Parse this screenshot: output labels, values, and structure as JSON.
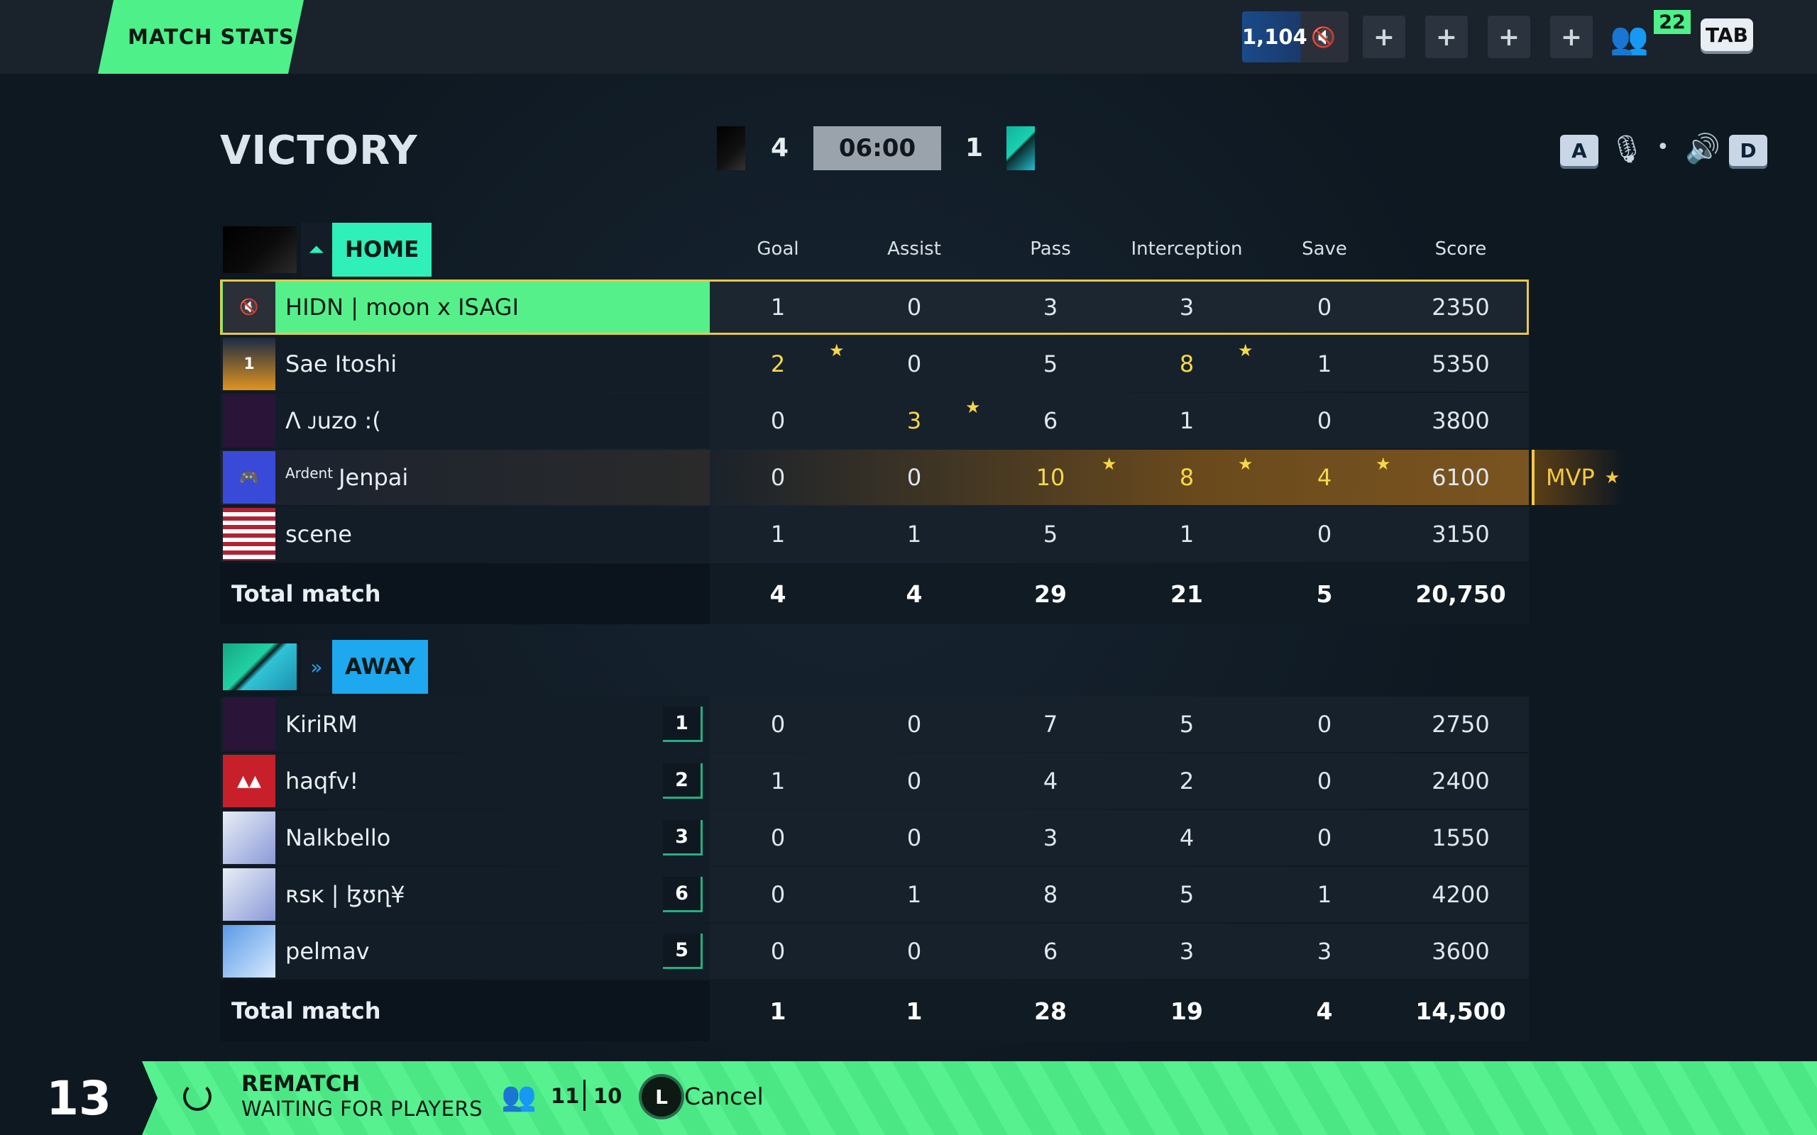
{
  "topbar": {
    "tab_label": "MATCH STATS",
    "elo": "1,104",
    "plus": "+",
    "party_count": "22",
    "tab_key": "TAB"
  },
  "header": {
    "result": "VICTORY",
    "home_score": "4",
    "timer": "06:00",
    "away_score": "1",
    "key_left": "A",
    "key_right": "D"
  },
  "columns": [
    "Goal",
    "Assist",
    "Pass",
    "Interception",
    "Save",
    "Score"
  ],
  "home": {
    "team_name": "HOME",
    "players": [
      {
        "name": "HIDN | moon x ISAGI",
        "prefix": "",
        "stats": [
          "1",
          "0",
          "3",
          "3",
          "0",
          "2350"
        ],
        "gold": [
          false,
          false,
          false,
          false,
          false,
          false
        ],
        "stars": [
          false,
          false,
          false,
          false,
          false,
          false
        ]
      },
      {
        "name": "Sae Itoshi",
        "prefix": "",
        "stats": [
          "2",
          "0",
          "5",
          "8",
          "1",
          "5350"
        ],
        "gold": [
          true,
          false,
          false,
          true,
          false,
          false
        ],
        "stars": [
          true,
          false,
          false,
          true,
          false,
          false
        ]
      },
      {
        "name": "Λ ᴊuzo :(",
        "prefix": "",
        "stats": [
          "0",
          "3",
          "6",
          "1",
          "0",
          "3800"
        ],
        "gold": [
          false,
          true,
          false,
          false,
          false,
          false
        ],
        "stars": [
          false,
          true,
          false,
          false,
          false,
          false
        ]
      },
      {
        "name": "Jenpai",
        "prefix": "Ardent",
        "stats": [
          "0",
          "0",
          "10",
          "8",
          "4",
          "6100"
        ],
        "gold": [
          false,
          false,
          true,
          true,
          true,
          false
        ],
        "stars": [
          false,
          false,
          true,
          true,
          true,
          false
        ]
      },
      {
        "name": "scene",
        "prefix": "",
        "stats": [
          "1",
          "1",
          "5",
          "1",
          "0",
          "3150"
        ],
        "gold": [
          false,
          false,
          false,
          false,
          false,
          false
        ],
        "stars": [
          false,
          false,
          false,
          false,
          false,
          false
        ]
      }
    ],
    "total_label": "Total match",
    "totals": [
      "4",
      "4",
      "29",
      "21",
      "5",
      "20,750"
    ],
    "mvp_label": "MVP"
  },
  "away": {
    "team_name": "AWAY",
    "players": [
      {
        "name": "KiriRM",
        "rank": "1",
        "stats": [
          "0",
          "0",
          "7",
          "5",
          "0",
          "2750"
        ]
      },
      {
        "name": "haqfv!",
        "rank": "2",
        "stats": [
          "1",
          "0",
          "4",
          "2",
          "0",
          "2400"
        ]
      },
      {
        "name": "Nalkbello",
        "rank": "3",
        "stats": [
          "0",
          "0",
          "3",
          "4",
          "0",
          "1550"
        ]
      },
      {
        "name": "ʀsᴋ | ɮʊղ¥",
        "rank": "6",
        "stats": [
          "0",
          "1",
          "8",
          "5",
          "1",
          "4200"
        ]
      },
      {
        "name": "pelmav",
        "rank": "5",
        "stats": [
          "0",
          "0",
          "6",
          "3",
          "3",
          "3600"
        ]
      }
    ],
    "total_label": "Total match",
    "totals": [
      "1",
      "1",
      "28",
      "19",
      "4",
      "14,500"
    ]
  },
  "footer": {
    "countdown": "13",
    "title": "REMATCH",
    "subtitle": "WAITING FOR PLAYERS",
    "count_a": "11",
    "count_b": "10",
    "cancel_key": "L",
    "cancel_label": "Cancel"
  },
  "colors": {
    "accent_green": "#4ef08a",
    "home_teal": "#2ef0b8",
    "away_blue": "#1ea8f0",
    "gold": "#f5d84a",
    "background": "#0e1821"
  },
  "icons": [
    "mute-icon",
    "plus-icon",
    "party-icon",
    "mic-off-icon",
    "volume-icon",
    "spinner-icon",
    "star-icon",
    "discord-icon"
  ]
}
